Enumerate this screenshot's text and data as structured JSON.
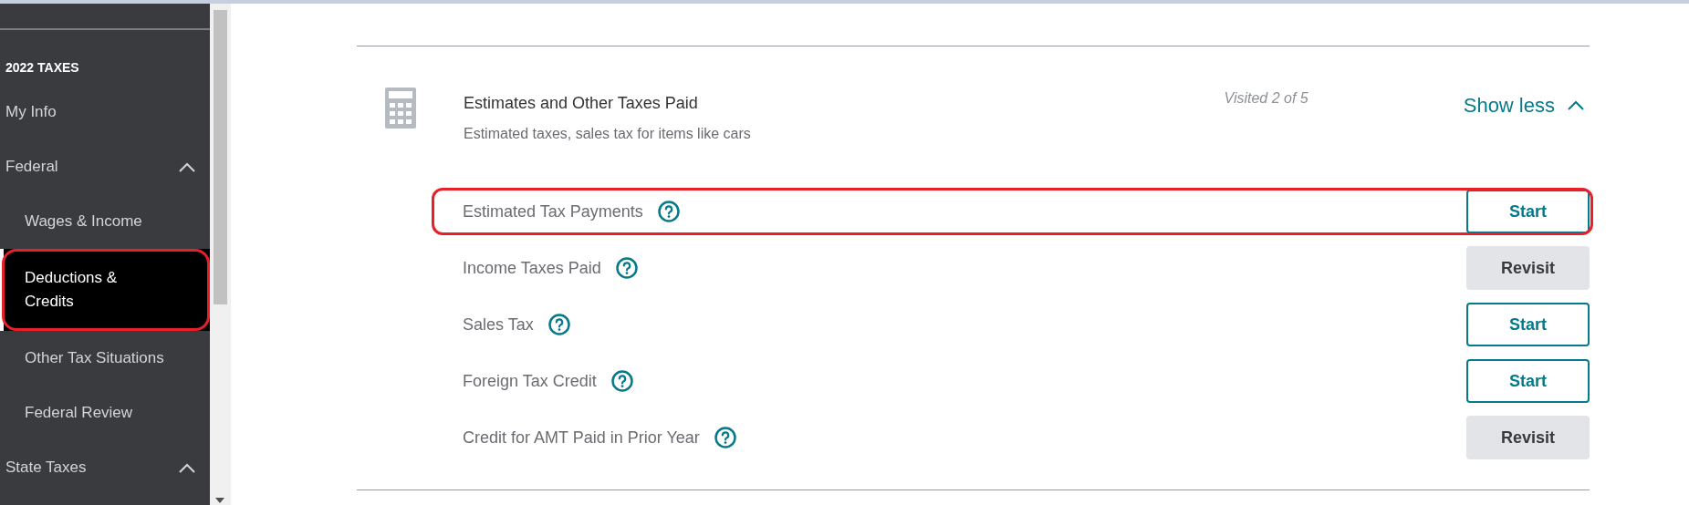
{
  "sidebar": {
    "heading": "2022 TAXES",
    "items": [
      {
        "label": "My Info",
        "selected": false,
        "annotated": false
      },
      {
        "label": "Federal",
        "selected": false,
        "annotated": false,
        "expanded": true,
        "children": [
          {
            "label": "Wages & Income",
            "selected": false,
            "annotated": false
          },
          {
            "label": "Deductions & Credits",
            "selected": true,
            "annotated": true
          },
          {
            "label": "Other Tax Situations",
            "selected": false,
            "annotated": false
          },
          {
            "label": "Federal Review",
            "selected": false,
            "annotated": false
          }
        ]
      },
      {
        "label": "State Taxes",
        "selected": false,
        "annotated": false,
        "expanded": true
      }
    ]
  },
  "section": {
    "title": "Estimates and Other Taxes Paid",
    "subtitle": "Estimated taxes, sales tax for items like cars",
    "progress": "Visited 2 of 5",
    "toggle": {
      "label": "Show less",
      "expanded": true
    },
    "rows": [
      {
        "label": "Estimated Tax Payments",
        "annotated": true,
        "action": {
          "kind": "start",
          "label": "Start"
        }
      },
      {
        "label": "Income Taxes Paid",
        "annotated": false,
        "action": {
          "kind": "revisit",
          "label": "Revisit"
        }
      },
      {
        "label": "Sales Tax",
        "annotated": false,
        "action": {
          "kind": "start",
          "label": "Start"
        }
      },
      {
        "label": "Foreign Tax Credit",
        "annotated": false,
        "action": {
          "kind": "start",
          "label": "Start"
        }
      },
      {
        "label": "Credit for AMT Paid in Prior Year",
        "annotated": false,
        "action": {
          "kind": "revisit",
          "label": "Revisit"
        }
      }
    ]
  }
}
